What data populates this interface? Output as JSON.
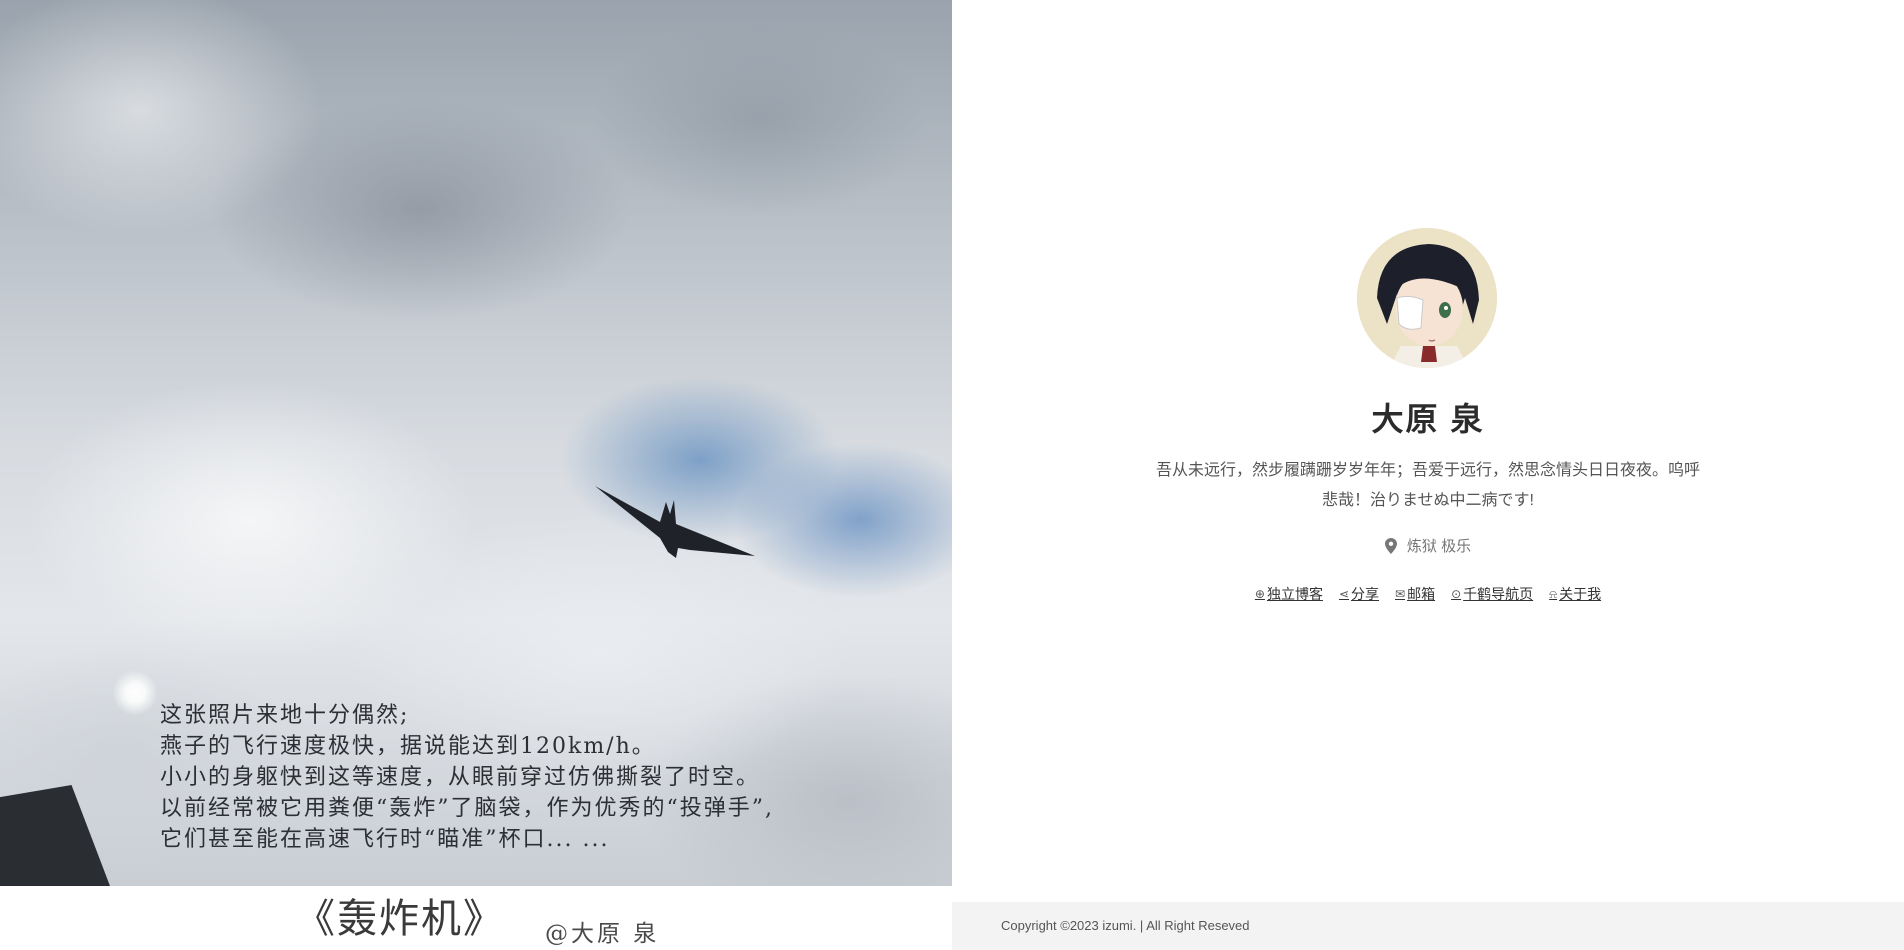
{
  "photo": {
    "poem_lines": [
      "这张照片来地十分偶然;",
      "燕子的飞行速度极快，据说能达到120km/h。",
      "小小的身躯快到这等速度，从眼前穿过仿佛撕裂了时空。",
      "以前经常被它用粪便“轰炸”了脑袋，作为优秀的“投弹手”,",
      "它们甚至能在高速飞行时“瞄准”杯口... ..."
    ],
    "title": "《轰炸机》",
    "author": "@大原 泉"
  },
  "profile": {
    "name": "大原 泉",
    "bio": "吾从未远行，然步履蹒跚岁岁年年；吾爱于远行，然思念情头日日夜夜。呜呼悲哉！治りませぬ中二病です!",
    "location": "炼狱 极乐",
    "links": [
      {
        "label": "独立博客",
        "icon": "blog-icon",
        "glyph": "⊕"
      },
      {
        "label": "分享",
        "icon": "share-icon",
        "glyph": "⋖"
      },
      {
        "label": "邮箱",
        "icon": "mail-icon",
        "glyph": "✉"
      },
      {
        "label": "千鹤导航页",
        "icon": "compass-icon",
        "glyph": "⊙"
      },
      {
        "label": "关于我",
        "icon": "bell-icon",
        "glyph": "⍾"
      }
    ]
  },
  "footer": {
    "copyright": "Copyright ©2023 izumi. | All Right Reseved"
  },
  "colors": {
    "text_dark": "#2b2b2b",
    "text_muted": "#555555",
    "footer_bg": "#f3f3f3"
  }
}
